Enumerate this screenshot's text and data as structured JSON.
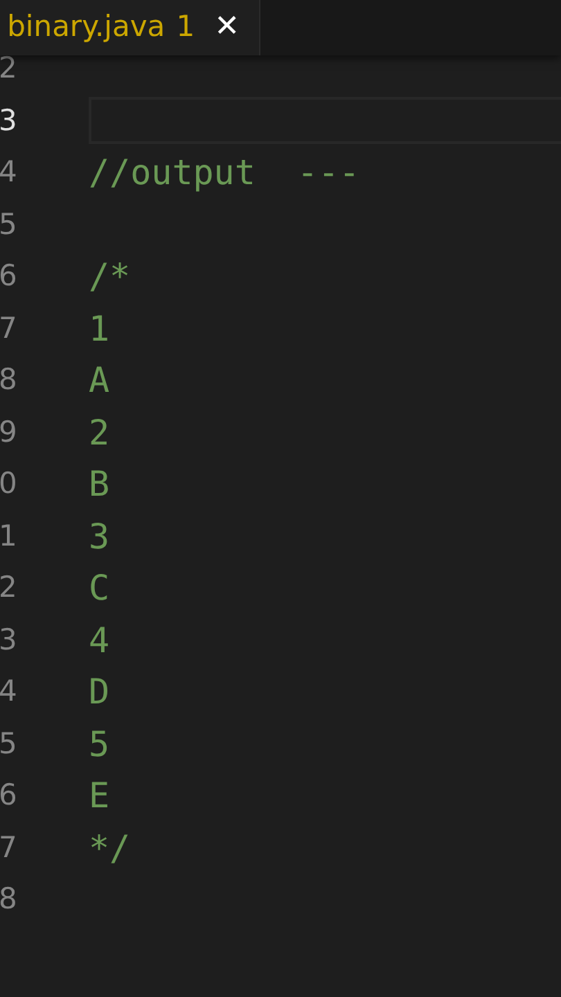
{
  "tab": {
    "filename": "binary.java",
    "problems": "1",
    "close": "✕",
    "selected": true
  },
  "lines": [
    {
      "number": "2",
      "current": false
    },
    {
      "number": "3",
      "current": true
    },
    {
      "number": "4",
      "code": "//output  ---",
      "current": false
    },
    {
      "number": "5",
      "current": false
    },
    {
      "number": "6",
      "code": "/*",
      "current": false
    },
    {
      "number": "7",
      "code": "1",
      "current": false
    },
    {
      "number": "8",
      "code": "A",
      "current": false
    },
    {
      "number": "9",
      "code": "2",
      "current": false
    },
    {
      "number": "0",
      "code": "B",
      "current": false
    },
    {
      "number": "1",
      "code": "3",
      "current": false
    },
    {
      "number": "2",
      "code": "C",
      "current": false
    },
    {
      "number": "3",
      "code": "4",
      "current": false
    },
    {
      "number": "4",
      "code": "D",
      "current": false
    },
    {
      "number": "5",
      "code": "5",
      "current": false
    },
    {
      "number": "6",
      "code": "E",
      "current": false
    },
    {
      "number": "7",
      "code": "*/",
      "current": false
    },
    {
      "number": "8",
      "current": false
    }
  ]
}
